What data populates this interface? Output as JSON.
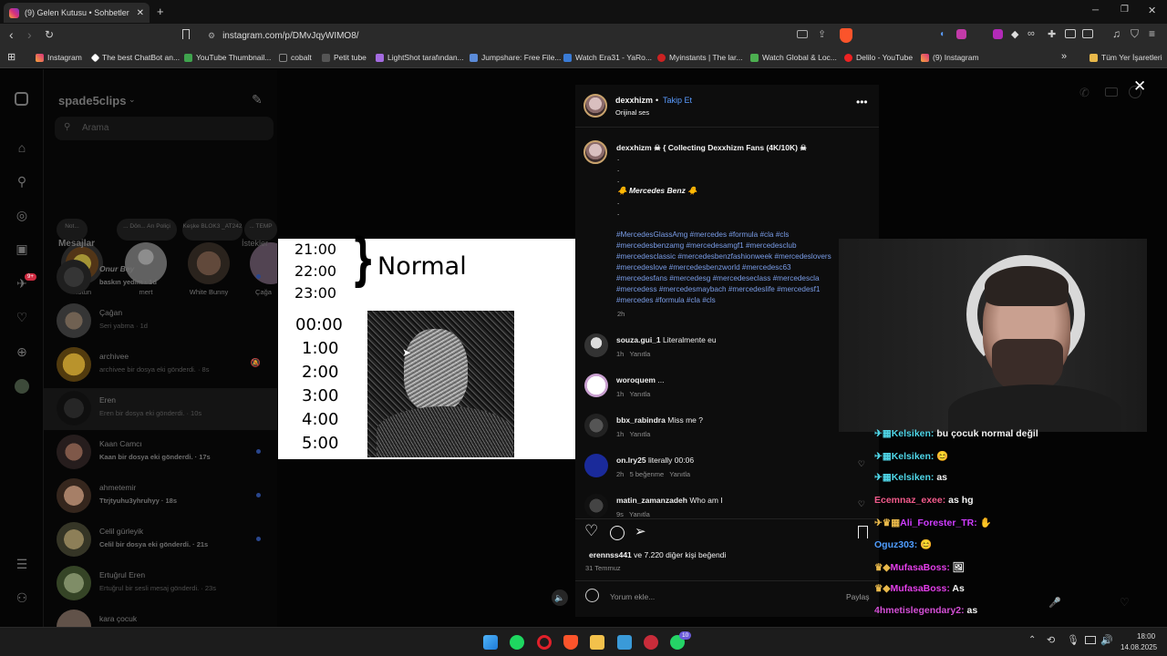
{
  "browser": {
    "tab_title": "(9) Gelen Kutusu • Sohbetler",
    "url": "instagram.com/p/DMvJqyWIMO8/",
    "bookmarks": [
      "Instagram",
      "The best ChatBot an...",
      "YouTube Thumbnail...",
      "cobalt",
      "Petit tube",
      "LightShot tarafından...",
      "Jumpshare: Free File...",
      "Watch Era31 - YaRo...",
      "Myinstants | The lar...",
      "Watch Global & Loc...",
      "Delilo - YouTube",
      "(9) Instagram"
    ],
    "all_bookmarks": "Tüm Yer İşaretleri"
  },
  "dm": {
    "username": "spade5clips",
    "search_placeholder": "Arama",
    "notes": [
      "Not...",
      "... Dön... Arı Poliçi",
      "Keşke BLOK3 _AT242",
      "... TEMP"
    ],
    "stories": [
      "Notun",
      "mert",
      "White Bunny",
      "Çağa"
    ],
    "messages_header": "Mesajlar",
    "requests": "İstekler",
    "messages": [
      {
        "name": "Onur Bey",
        "preview": "baskın yedim · 1d"
      },
      {
        "name": "Çağan",
        "preview": "Seri yabma · 1d"
      },
      {
        "name": "archivee",
        "preview": "archivee bir dosya eki gönderdi. · 8s"
      },
      {
        "name": "Eren",
        "preview": "Eren bir dosya eki gönderdi. · 10s"
      },
      {
        "name": "Kaan Camcı",
        "preview": "Kaan bir dosya eki gönderdi. · 17s"
      },
      {
        "name": "ahmetemir",
        "preview": "Ttrjtyuhu3yhruhyy · 18s"
      },
      {
        "name": "Celil gürleyik",
        "preview": "Celil bir dosya eki gönderdi. · 21s"
      },
      {
        "name": "Ertuğrul Eren",
        "preview": "Ertuğrul bir sesli mesaj gönderdi. · 23s"
      },
      {
        "name": "kara çocuk",
        "preview": ""
      }
    ]
  },
  "post_image": {
    "times_top": [
      "21:00",
      "22:00",
      "23:00"
    ],
    "label": "Normal",
    "times_bottom": [
      "00:00",
      "1:00",
      "2:00",
      "3:00",
      "4:00",
      "5:00"
    ]
  },
  "post": {
    "author": "dexxhizm",
    "follow": "Takip Et",
    "audio": "Orijinal ses",
    "caption_head": "dexxhizm ☠ { Collecting Dexxhizm Fans (4K/10K) ☠",
    "caption_dots": [
      ".",
      ".",
      "."
    ],
    "caption_brand": "🐥 Mercedes Benz 🐥",
    "caption_dots2": [
      ".",
      "."
    ],
    "hashtags": [
      "#MercedesGlassAmg #mercedes #formula #cla #cls",
      "#mercedesbenzamg #mercedesamgf1 #mercedesclub",
      "#mercedesclassic #mercedesbenzfashionweek #mercedeslovers",
      "#mercedeslove #mercedesbenzworld #mercedesc63",
      "#mercedesfans #mercedesg #mercedeseclass #mercedescla",
      "#mercedess #mercedesmaybach #mercedeslife #mercedesf1",
      "#mercedes #formula #cla #cls"
    ],
    "caption_time": "2h",
    "comments": [
      {
        "user": "souza.gui_1",
        "text": "Literalmente eu",
        "meta": "1h   Yanıtla"
      },
      {
        "user": "woroquem",
        "text": "...",
        "meta": "1h   Yanıtla"
      },
      {
        "user": "bbx_rabindra",
        "text": "Miss me ?",
        "meta": "1h   Yanıtla"
      },
      {
        "user": "on.lry25",
        "text": "literally 00:06",
        "meta": "2h   5 beğenme   Yanıtla"
      },
      {
        "user": "matin_zamanzadeh",
        "text": "Who am I",
        "meta": "9s   Yanıtla"
      }
    ],
    "likes_user": "erennss441",
    "likes_rest": " ve 7.220 diğer kişi beğendi",
    "date": "31 Temmuz",
    "comment_placeholder": "Yorum ekle...",
    "share": "Paylaş"
  },
  "chat": [
    {
      "user": "Kelsiken:",
      "msg": "bu çocuk normal değil",
      "color": "#4fd6e8"
    },
    {
      "user": "Kelsiken:",
      "msg": "😊",
      "color": "#4fd6e8"
    },
    {
      "user": "Kelsiken:",
      "msg": "as",
      "color": "#4fd6e8"
    },
    {
      "user": "Ecemnaz_exee:",
      "msg": "as hg",
      "color": "#f05a8a"
    },
    {
      "user": "Ali_Forester_TR:",
      "msg": "✋",
      "color": "#cf3cff"
    },
    {
      "user": "Oguz303:",
      "msg": "😊",
      "color": "#4f9dff"
    },
    {
      "user": "MufasaBoss:",
      "msg": "🖼",
      "color": "#e23ee8"
    },
    {
      "user": "MufasaBoss:",
      "msg": "As",
      "color": "#e23ee8"
    },
    {
      "user": "4hmetislegendary2:",
      "msg": "as",
      "color": "#d44fd6"
    },
    {
      "user": "4hmetislegendary2:",
      "msg": "😊",
      "color": "#d44fd6"
    }
  ],
  "taskbar": {
    "time": "18:00",
    "date": "14.08.2025",
    "whatsapp_badge": "10"
  },
  "dm_badge": "9+",
  "colors": {
    "accent": "#0095f6",
    "link": "#7a9de8",
    "brave": "#fb542b"
  }
}
